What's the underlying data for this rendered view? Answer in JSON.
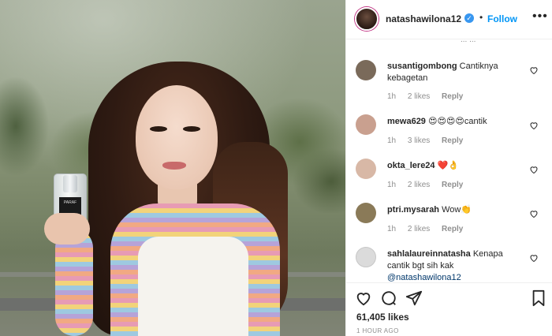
{
  "post": {
    "author": "natashawilona12",
    "verified_mark": "✓",
    "separator": "•",
    "follow_label": "Follow",
    "more_label": "•••",
    "photo_bottle_label": "PARAF",
    "top_fragment": "... ..."
  },
  "comments": [
    {
      "username": "susantigombong",
      "text": "Cantiknya kebagetan",
      "time": "1h",
      "likes": "2 likes",
      "reply": "Reply",
      "avatar_color": "#7a6a5a"
    },
    {
      "username": "mewa629",
      "text": "😍😍😍😍cantik",
      "time": "1h",
      "likes": "3 likes",
      "reply": "Reply",
      "avatar_color": "#c9a08f"
    },
    {
      "username": "okta_lere24",
      "text": "❤️👌",
      "time": "1h",
      "likes": "2 likes",
      "reply": "Reply",
      "avatar_color": "#d8b8a6"
    },
    {
      "username": "ptri.mysarah",
      "text": "Wow👏",
      "time": "1h",
      "likes": "2 likes",
      "reply": "Reply",
      "avatar_color": "#8a7a58"
    },
    {
      "username": "sahlalaureinnatasha",
      "text": "Kenapa cantik bgt sih kak",
      "mention": "@natashawilona12",
      "avatar_color": "#dbdbdb"
    }
  ],
  "footer": {
    "likes_count": "61,405 likes",
    "timestamp": "1 HOUR AGO"
  },
  "colors": {
    "accent": "#0095f6",
    "verified": "#3897f0",
    "meta_gray": "#8e8e8e",
    "text": "#262626"
  },
  "icons": [
    "heart-icon",
    "comment-icon",
    "share-icon",
    "bookmark-icon",
    "verified-badge-icon",
    "more-icon"
  ]
}
